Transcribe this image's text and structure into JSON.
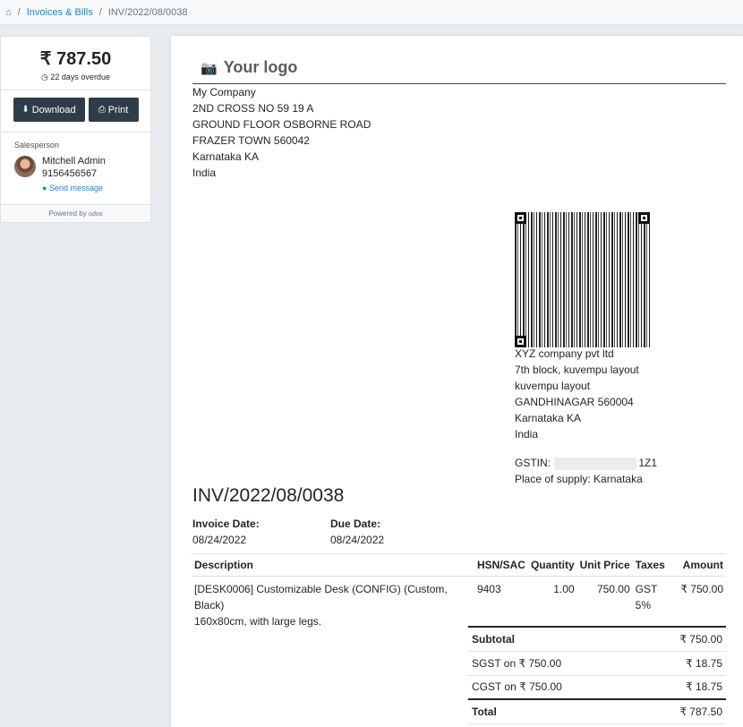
{
  "breadcrumb": {
    "home_icon": "home-icon",
    "items": [
      "Invoices & Bills",
      "INV/2022/08/0038"
    ]
  },
  "sidebar": {
    "amount": "₹ 787.50",
    "overdue": "22 days overdue",
    "download_label": "Download",
    "print_label": "Print",
    "salesperson_label": "Salesperson",
    "salesperson_name": "Mitchell Admin",
    "salesperson_phone": "9156456567",
    "send_message": "Send message",
    "powered_by": "Powered by",
    "powered_brand": "odoo"
  },
  "invoice": {
    "logo_text": "Your logo",
    "company": [
      "My Company",
      "2ND CROSS NO 59 19 A",
      "GROUND FLOOR OSBORNE ROAD",
      "FRAZER TOWN 560042",
      "Karnataka KA",
      "India"
    ],
    "customer": [
      "XYZ company pvt ltd",
      "7th block, kuvempu layout",
      "kuvempu layout",
      "GANDHINAGAR 560004",
      "Karnataka KA",
      "India"
    ],
    "gstin_label": "GSTIN:",
    "gstin_suffix": "1Z1",
    "place_of_supply": "Place of supply: Karnataka",
    "number": "INV/2022/08/0038",
    "invoice_date_label": "Invoice Date:",
    "invoice_date": "08/24/2022",
    "due_date_label": "Due Date:",
    "due_date": "08/24/2022",
    "columns": [
      "Description",
      "HSN/SAC",
      "Quantity",
      "Unit Price",
      "Taxes",
      "Amount"
    ],
    "lines": [
      {
        "description": "[DESK0006] Customizable Desk (CONFIG) (Custom, Black)",
        "description2": "160x80cm, with large legs.",
        "hsn": "9403",
        "quantity": "1.00",
        "unit_price": "750.00",
        "taxes": "GST 5%",
        "amount": "₹ 750.00"
      }
    ],
    "totals": {
      "subtotal_label": "Subtotal",
      "subtotal": "₹ 750.00",
      "sgst_label": "SGST on ₹ 750.00",
      "sgst": "₹ 18.75",
      "cgst_label": "CGST on ₹ 750.00",
      "cgst": "₹ 18.75",
      "total_label": "Total",
      "total": "₹ 787.50"
    }
  }
}
